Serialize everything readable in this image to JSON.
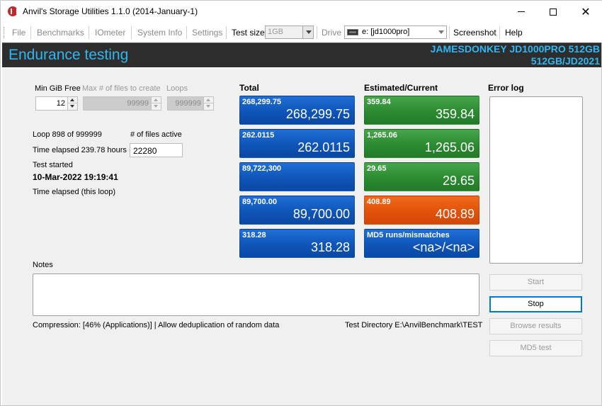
{
  "window": {
    "title": "Anvil's Storage Utilities 1.1.0 (2014-January-1)"
  },
  "menu": {
    "file": "File",
    "benchmarks": "Benchmarks",
    "iometer": "IOmeter",
    "system_info": "System Info",
    "settings": "Settings",
    "test_size_label": "Test size",
    "test_size_value": "1GB",
    "drive_label": "Drive",
    "drive_value": "e: [jd1000pro]",
    "screenshot": "Screenshot",
    "help": "Help"
  },
  "banner": {
    "title": "Endurance testing",
    "drive_line1": "JAMESDONKEY JD1000PRO 512GB",
    "drive_line2": "512GB/JD2021"
  },
  "params": {
    "min_gib_free_label": "Min GiB Free",
    "min_gib_free_value": "12",
    "max_files_label": "Max # of files to create",
    "max_files_value": "99999",
    "loops_label": "Loops",
    "loops_value": "999999"
  },
  "status": {
    "loop_text": "Loop 898 of 999999",
    "files_active_label": "# of files active",
    "files_active_value": "22280",
    "time_elapsed": "Time elapsed 239.78 hours",
    "test_started_label": "Test started",
    "test_started_value": "10-Mar-2022 19:19:41",
    "time_elapsed_loop": "Time elapsed (this loop)"
  },
  "headings": {
    "total": "Total",
    "estimated_current": "Estimated/Current",
    "error_log": "Error log",
    "notes": "Notes"
  },
  "total_tiles": [
    {
      "small": "268,299.75",
      "big": "268,299.75"
    },
    {
      "small": "262.0115",
      "big": "262.0115"
    },
    {
      "small": "89,722,300",
      "big": ""
    },
    {
      "small": "89,700.00",
      "big": "89,700.00"
    },
    {
      "small": "318.28",
      "big": "318.28"
    }
  ],
  "current_tiles": [
    {
      "small": "359.84",
      "big": "359.84",
      "color": "#2c8b31"
    },
    {
      "small": "1,265.06",
      "big": "1,265.06",
      "color": "#2c8b31"
    },
    {
      "small": "29.65",
      "big": "29.65",
      "color": "#2c8b31"
    },
    {
      "small": "408.89",
      "big": "408.89",
      "color": "#e2520a"
    },
    {
      "small": "MD5 runs/mismatches",
      "big": "<na>/<na>",
      "color": "#0f55b8"
    }
  ],
  "footer": {
    "compression": "Compression: [46% (Applications)] | Allow deduplication of random data",
    "test_directory": "Test Directory E:\\AnvilBenchmark\\TEST"
  },
  "buttons": {
    "start": "Start",
    "stop": "Stop",
    "browse_results": "Browse results",
    "md5_test": "MD5 test"
  },
  "colors": {
    "banner_bg": "#2d2d2d",
    "banner_text": "#2fb7f2",
    "tile_blue": "#0f55b8",
    "tile_green": "#2c8b31",
    "tile_orange": "#e2520a"
  }
}
